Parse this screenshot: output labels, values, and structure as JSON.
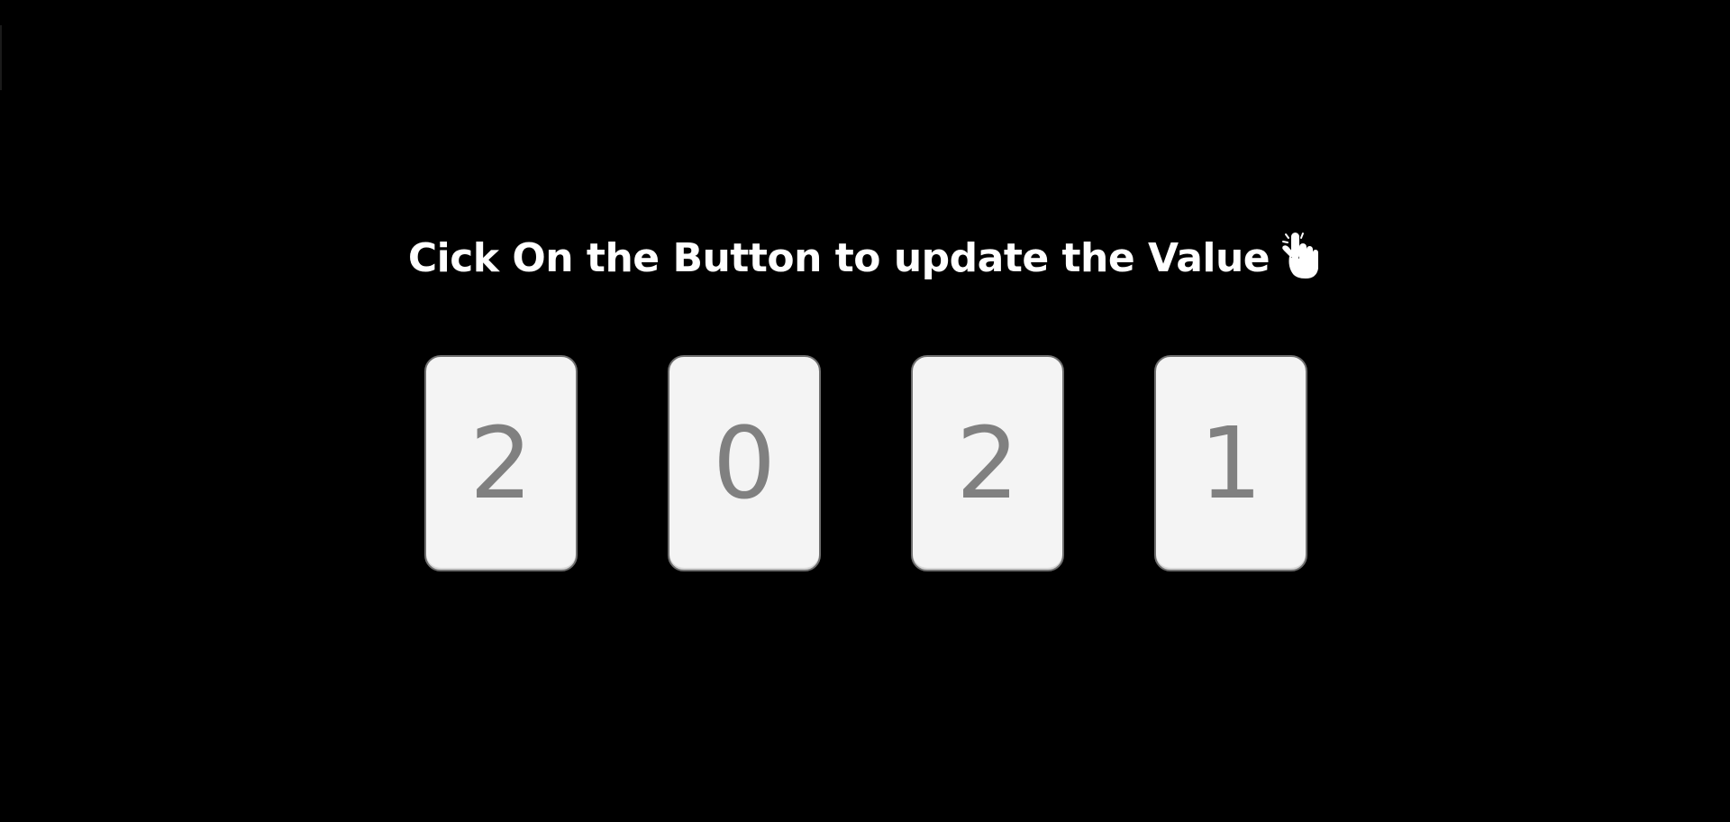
{
  "heading": {
    "text": "Cick On the Button to update the Value",
    "icon": "pointing-hand-icon"
  },
  "cards": [
    {
      "value": "2"
    },
    {
      "value": "0"
    },
    {
      "value": "2"
    },
    {
      "value": "1"
    }
  ],
  "colors": {
    "background": "#000000",
    "card_background": "#f4f4f4",
    "card_border": "#6f6f6f",
    "digit": "#808080",
    "heading": "#ffffff"
  }
}
